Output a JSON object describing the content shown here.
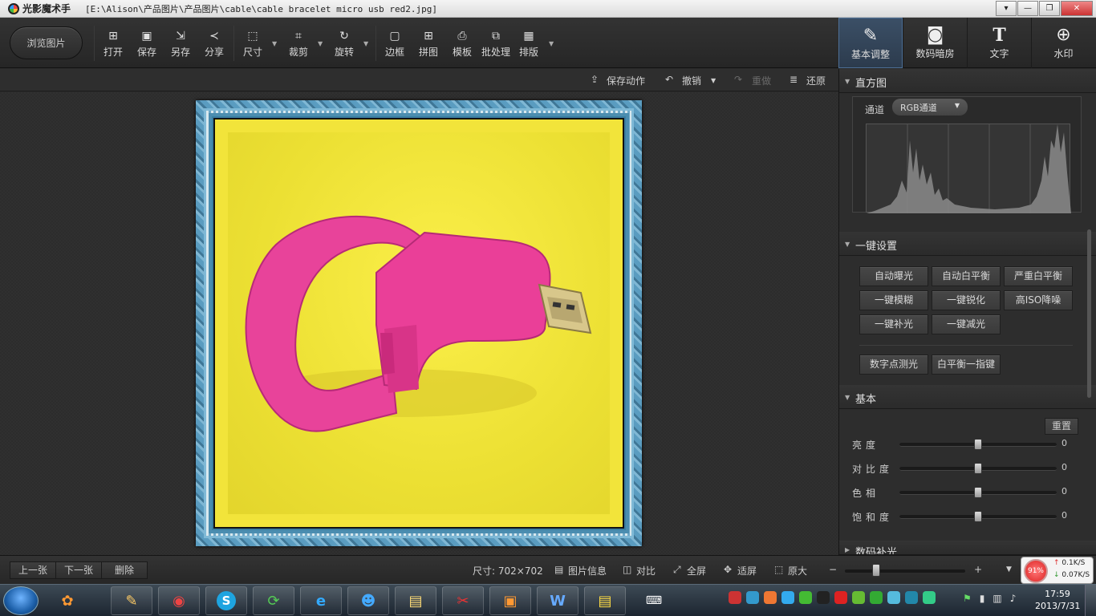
{
  "window": {
    "app_name": "光影魔术手",
    "file_path": "[E:\\Alison\\产品图片\\产品图片\\cable\\cable bracelet micro usb red2.jpg]",
    "controls": {
      "dropdown": "▾",
      "minimize": "—",
      "restore": "❐",
      "close": "✕"
    }
  },
  "toolbar": {
    "browse_label": "浏览图片",
    "buttons": [
      {
        "label": "打开",
        "icon": "open-icon"
      },
      {
        "label": "保存",
        "icon": "save-icon"
      },
      {
        "label": "另存",
        "icon": "save-as-icon"
      },
      {
        "label": "分享",
        "icon": "share-icon"
      },
      {
        "label": "尺寸",
        "icon": "resize-icon"
      },
      {
        "label": "裁剪",
        "icon": "crop-icon"
      },
      {
        "label": "旋转",
        "icon": "rotate-icon"
      },
      {
        "label": "边框",
        "icon": "border-icon"
      },
      {
        "label": "拼图",
        "icon": "collage-icon"
      },
      {
        "label": "模板",
        "icon": "template-icon"
      },
      {
        "label": "批处理",
        "icon": "batch-icon"
      },
      {
        "label": "排版",
        "icon": "layout-icon"
      }
    ]
  },
  "right_tabs": [
    {
      "label": "基本调整",
      "icon": "adjust-icon",
      "active": true
    },
    {
      "label": "数码暗房",
      "icon": "camera-icon",
      "active": false
    },
    {
      "label": "文字",
      "icon": "text-icon",
      "active": false
    },
    {
      "label": "水印",
      "icon": "watermark-icon",
      "active": false
    }
  ],
  "action_bar": {
    "save_action": "保存动作",
    "undo": "撤销",
    "redo": "重做",
    "restore": "还原"
  },
  "histogram": {
    "title": "直方图",
    "channel_label": "通道",
    "channel_value": "RGB通道"
  },
  "one_click": {
    "title": "一键设置",
    "buttons": [
      "自动曝光",
      "自动白平衡",
      "严重白平衡",
      "一键模糊",
      "一键锐化",
      "高ISO降噪",
      "一键补光",
      "一键减光",
      "数字点测光",
      "白平衡一指键"
    ]
  },
  "basic": {
    "title": "基本",
    "reset": "重置",
    "sliders": [
      {
        "label": "亮度",
        "value": "0",
        "level": 0.5
      },
      {
        "label": "对比度",
        "value": "0",
        "level": 0.5
      },
      {
        "label": "色相",
        "value": "0",
        "level": 0.5
      },
      {
        "label": "饱和度",
        "value": "0",
        "level": 0.5
      }
    ]
  },
  "next_section": "数码补光",
  "bottom_bar": {
    "prev": "上一张",
    "next": "下一张",
    "delete": "删除",
    "size_text": "尺寸: 702×702",
    "info": "图片信息",
    "compare": "对比",
    "fullscreen": "全屏",
    "fit": "适屏",
    "original": "原大",
    "zoom_minus": "−",
    "zoom_plus": "+",
    "net": {
      "percent": "91%",
      "up": "0.1K/S",
      "down": "0.07K/S"
    }
  },
  "taskbar": {
    "time": "17:59",
    "date": "2013/7/31"
  }
}
